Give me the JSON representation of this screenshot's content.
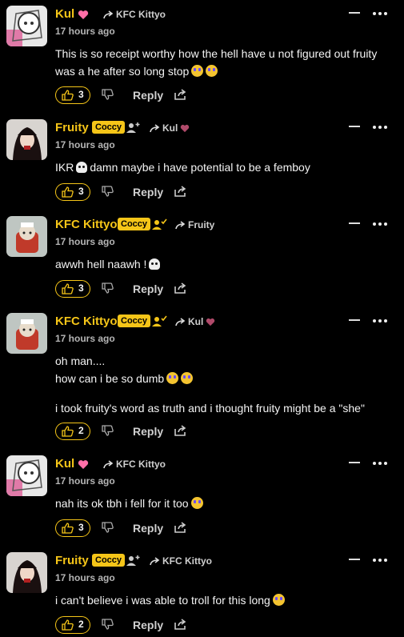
{
  "comments": [
    {
      "username": "Kul",
      "badge": "",
      "user_icon": "heart-icon",
      "reply_to": "KFC Kittyo",
      "reply_to_icon": "",
      "time": "17 hours ago",
      "lines": [
        "This is so receipt worthy how the hell have u not figured out fruity",
        "was a he after so long stop"
      ],
      "likes": "3",
      "reply_label": "Reply"
    },
    {
      "username": "Fruity",
      "badge": "Coccy",
      "user_icon": "user-plus-icon",
      "reply_to": "Kul",
      "reply_to_icon": "heart-icon",
      "time": "17 hours ago",
      "lines": [
        "IKR",
        "damn maybe i have potential to be a femboy"
      ],
      "likes": "3",
      "reply_label": "Reply"
    },
    {
      "username": "KFC Kittyo",
      "badge": "Coccy",
      "user_icon": "user-check-icon",
      "reply_to": "Fruity",
      "reply_to_icon": "",
      "time": "17 hours ago",
      "lines": [
        "awwh hell naawh !"
      ],
      "likes": "3",
      "reply_label": "Reply"
    },
    {
      "username": "KFC Kittyo",
      "badge": "Coccy",
      "user_icon": "user-check-icon",
      "reply_to": "Kul",
      "reply_to_icon": "heart-icon",
      "time": "17 hours ago",
      "lines": [
        "oh man....",
        "how can i be so dumb",
        "i took fruity's word as truth and i thought fruity might be a \"she\""
      ],
      "likes": "2",
      "reply_label": "Reply"
    },
    {
      "username": "Kul",
      "badge": "",
      "user_icon": "heart-icon",
      "reply_to": "KFC Kittyo",
      "reply_to_icon": "",
      "time": "17 hours ago",
      "lines": [
        "nah its ok tbh i fell for it too"
      ],
      "likes": "3",
      "reply_label": "Reply"
    },
    {
      "username": "Fruity",
      "badge": "Coccy",
      "user_icon": "user-plus-icon",
      "reply_to": "KFC Kittyo",
      "reply_to_icon": "",
      "time": "17 hours ago",
      "lines": [
        "i can't believe i was able to troll for this long"
      ],
      "likes": "2",
      "reply_label": "Reply"
    }
  ],
  "colors": {
    "accent": "#f5c518",
    "heart": "#ff6fa8",
    "heart_dim": "#b04a6a",
    "background": "#000000"
  }
}
